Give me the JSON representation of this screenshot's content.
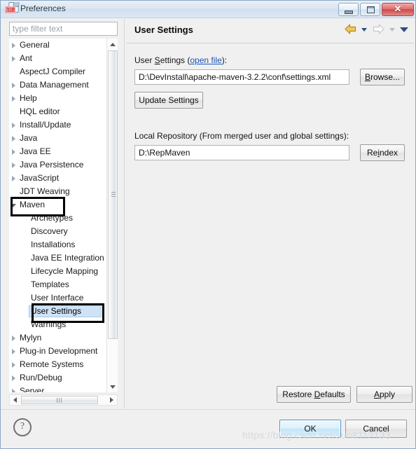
{
  "window": {
    "title": "Preferences",
    "icon_badge": "加速",
    "controls": {
      "minimize": "Minimize",
      "maximize": "Maximize",
      "close": "✕"
    }
  },
  "sidebar": {
    "filter": {
      "placeholder": "type filter text",
      "value": ""
    },
    "items": [
      {
        "label": "General",
        "indent": 0,
        "twisty": "collapsed",
        "selected": false
      },
      {
        "label": "Ant",
        "indent": 0,
        "twisty": "collapsed",
        "selected": false
      },
      {
        "label": "AspectJ Compiler",
        "indent": 0,
        "twisty": "none",
        "selected": false
      },
      {
        "label": "Data Management",
        "indent": 0,
        "twisty": "collapsed",
        "selected": false
      },
      {
        "label": "Help",
        "indent": 0,
        "twisty": "collapsed",
        "selected": false
      },
      {
        "label": "HQL editor",
        "indent": 0,
        "twisty": "none",
        "selected": false
      },
      {
        "label": "Install/Update",
        "indent": 0,
        "twisty": "collapsed",
        "selected": false
      },
      {
        "label": "Java",
        "indent": 0,
        "twisty": "collapsed",
        "selected": false
      },
      {
        "label": "Java EE",
        "indent": 0,
        "twisty": "collapsed",
        "selected": false
      },
      {
        "label": "Java Persistence",
        "indent": 0,
        "twisty": "collapsed",
        "selected": false
      },
      {
        "label": "JavaScript",
        "indent": 0,
        "twisty": "collapsed",
        "selected": false
      },
      {
        "label": "JDT Weaving",
        "indent": 0,
        "twisty": "none",
        "selected": false
      },
      {
        "label": "Maven",
        "indent": 0,
        "twisty": "expanded",
        "selected": false
      },
      {
        "label": "Archetypes",
        "indent": 1,
        "twisty": "none",
        "selected": false
      },
      {
        "label": "Discovery",
        "indent": 1,
        "twisty": "none",
        "selected": false
      },
      {
        "label": "Installations",
        "indent": 1,
        "twisty": "none",
        "selected": false
      },
      {
        "label": "Java EE Integration",
        "indent": 1,
        "twisty": "none",
        "selected": false
      },
      {
        "label": "Lifecycle Mapping",
        "indent": 1,
        "twisty": "none",
        "selected": false
      },
      {
        "label": "Templates",
        "indent": 1,
        "twisty": "none",
        "selected": false
      },
      {
        "label": "User Interface",
        "indent": 1,
        "twisty": "none",
        "selected": false
      },
      {
        "label": "User Settings",
        "indent": 1,
        "twisty": "none",
        "selected": true
      },
      {
        "label": "Warnings",
        "indent": 1,
        "twisty": "none",
        "selected": false
      },
      {
        "label": "Mylyn",
        "indent": 0,
        "twisty": "collapsed",
        "selected": false
      },
      {
        "label": "Plug-in Development",
        "indent": 0,
        "twisty": "collapsed",
        "selected": false
      },
      {
        "label": "Remote Systems",
        "indent": 0,
        "twisty": "collapsed",
        "selected": false
      },
      {
        "label": "Run/Debug",
        "indent": 0,
        "twisty": "collapsed",
        "selected": false
      },
      {
        "label": "Server",
        "indent": 0,
        "twisty": "collapsed",
        "selected": false
      }
    ]
  },
  "panel": {
    "title": "User Settings",
    "nav": {
      "back": "back-arrow",
      "forward": "forward-arrow",
      "menu": "view-menu"
    },
    "user_settings": {
      "label_prefix": "User ",
      "label_mnemonic": "S",
      "label_rest": "ettings (",
      "link": "open file",
      "label_suffix": "):",
      "path_value": "D:\\DevInstall\\apache-maven-3.2.2\\conf\\settings.xml",
      "browse_mnemonic": "B",
      "browse_rest": "rowse...",
      "update_label": "Update Settings"
    },
    "local_repository": {
      "label": "Local Repository (From merged user and global settings):",
      "path_value": "D:\\RepMaven",
      "reindex_prefix": "Re",
      "reindex_mnemonic": "i",
      "reindex_rest": "ndex"
    },
    "restore_defaults": {
      "prefix": "Restore ",
      "mnemonic": "D",
      "rest": "efaults"
    },
    "apply": {
      "mnemonic": "A",
      "rest": "pply"
    }
  },
  "footer": {
    "help": "?",
    "ok": "OK",
    "cancel": "Cancel"
  },
  "watermark": "https://blog.csdn.net/sun8112133",
  "colors": {
    "dialog_bg": "#f0f0f0",
    "titlebar": "#dce7f2",
    "selection": "#cfe3f7",
    "link": "#1b55b3",
    "default_button": "#c2e5f8",
    "annotation": "#000000",
    "nav_back": "#e8b93c"
  }
}
